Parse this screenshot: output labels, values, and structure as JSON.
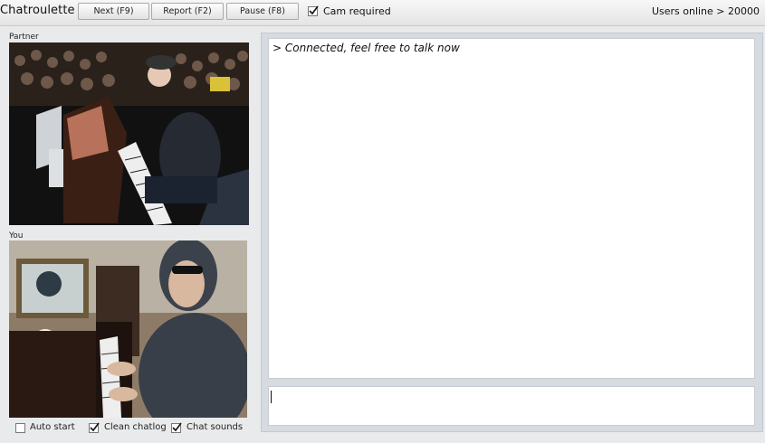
{
  "app": {
    "title": "Chatroulette"
  },
  "toolbar": {
    "next_label": "Next (F9)",
    "report_label": "Report (F2)",
    "pause_label": "Pause (F8)",
    "cam_required_label": "Cam required",
    "cam_required_checked": true
  },
  "status": {
    "users_online": "Users online > 20000"
  },
  "partner": {
    "label": "Partner"
  },
  "you": {
    "label": "You"
  },
  "chat": {
    "log": [
      "> Connected, feel free to talk now"
    ],
    "input_value": ""
  },
  "options": [
    {
      "label": "Auto start",
      "checked": false
    },
    {
      "label": "Clean chatlog",
      "checked": true
    },
    {
      "label": "Chat sounds",
      "checked": true
    }
  ]
}
